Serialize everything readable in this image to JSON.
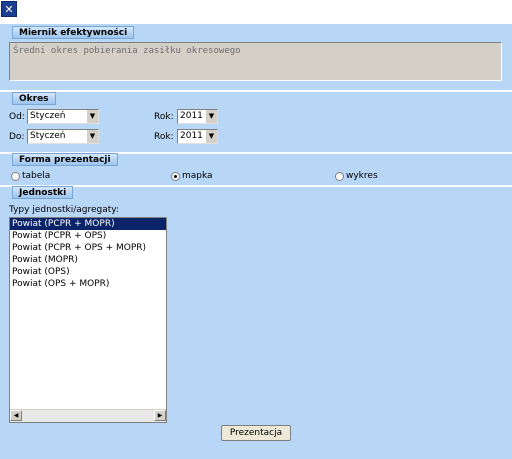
{
  "close_icon": "close-icon",
  "miernik": {
    "legend": "Miernik efektywności",
    "value": "Średni okres pobierania zasiłku okresowego"
  },
  "okres": {
    "legend": "Okres",
    "od_label": "Od:",
    "do_label": "Do:",
    "od_month": "Styczeń",
    "do_month": "Styczeń",
    "rok_label_1": "Rok:",
    "rok_label_2": "Rok:",
    "od_year": "2011",
    "do_year": "2011"
  },
  "forma": {
    "legend": "Forma prezentacji",
    "options": [
      "tabela",
      "mapka",
      "wykres"
    ],
    "selected": "mapka"
  },
  "jednostki": {
    "legend": "Jednostki",
    "types_label": "Typy jednostki/agregaty:",
    "items": [
      "Powiat (PCPR + MOPR)",
      "Powiat (PCPR + OPS)",
      "Powiat (PCPR + OPS + MOPR)",
      "Powiat (MOPR)",
      "Powiat (OPS)",
      "Powiat (OPS + MOPR)"
    ],
    "selected_index": 0
  },
  "button_label": "Prezentacja"
}
